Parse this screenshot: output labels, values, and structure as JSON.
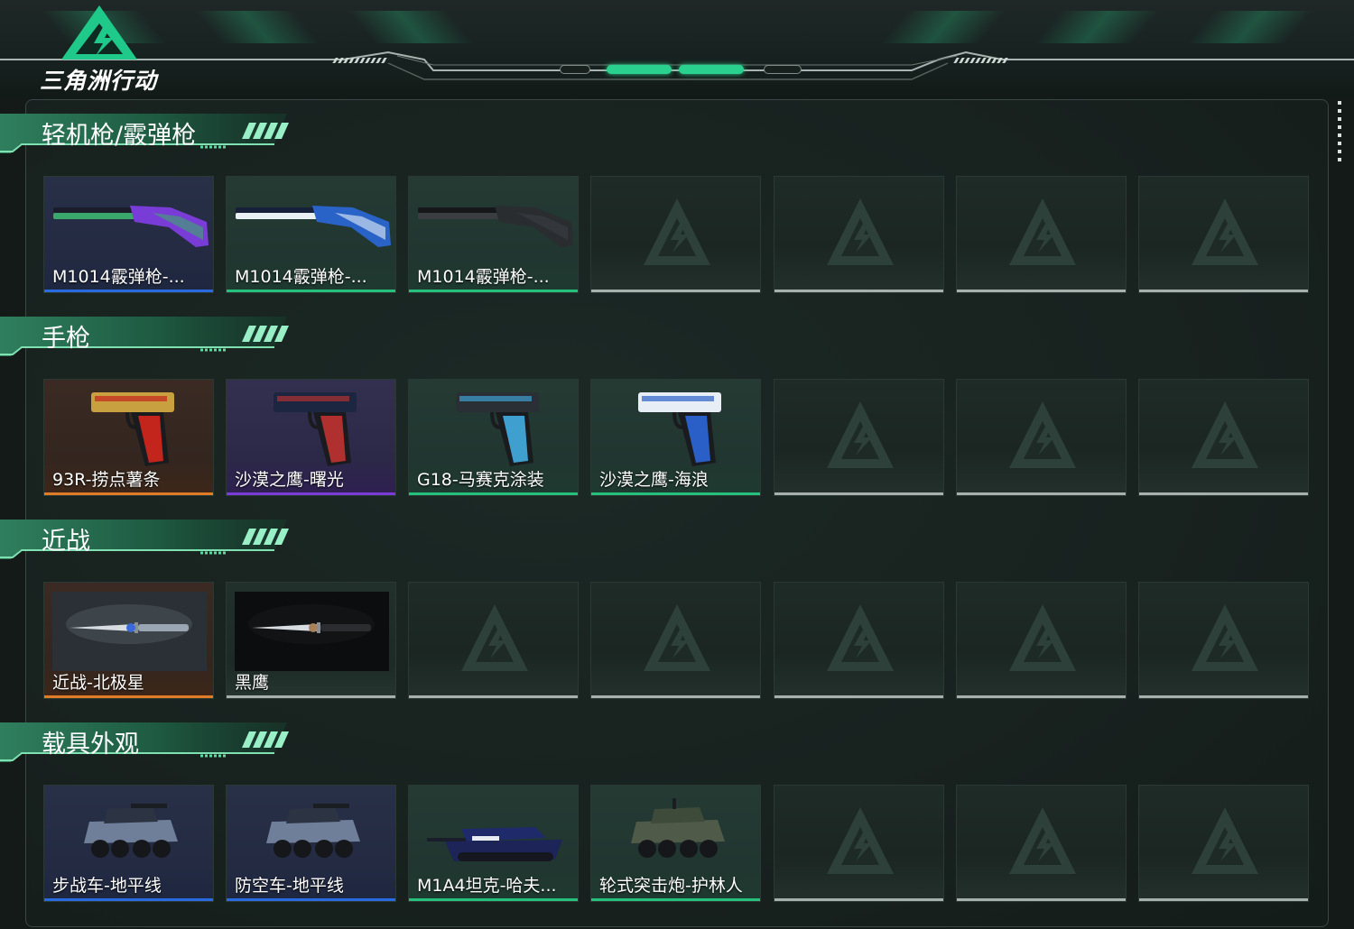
{
  "app": {
    "title": "三角洲行动"
  },
  "categories": [
    {
      "title": "轻机枪/霰弹枪",
      "items": [
        {
          "name": "M1014霰弹枪-...",
          "rarity": "blue",
          "icon": "shotgun-icon"
        },
        {
          "name": "M1014霰弹枪-...",
          "rarity": "green",
          "icon": "shotgun-icon"
        },
        {
          "name": "M1014霰弹枪-...",
          "rarity": "green",
          "icon": "shotgun-icon"
        }
      ],
      "empty_slots": 4
    },
    {
      "title": "手枪",
      "items": [
        {
          "name": "93R-捞点薯条",
          "rarity": "orange",
          "icon": "pistol-icon"
        },
        {
          "name": "沙漠之鹰-曙光",
          "rarity": "purple",
          "icon": "pistol-icon"
        },
        {
          "name": "G18-马赛克涂装",
          "rarity": "green",
          "icon": "pistol-icon"
        },
        {
          "name": "沙漠之鹰-海浪",
          "rarity": "green",
          "icon": "pistol-icon"
        }
      ],
      "empty_slots": 3
    },
    {
      "title": "近战",
      "items": [
        {
          "name": "近战-北极星",
          "rarity": "orange",
          "icon": "knife-icon"
        },
        {
          "name": "黑鹰",
          "rarity": "none",
          "icon": "knife-icon"
        }
      ],
      "empty_slots": 5
    },
    {
      "title": "载具外观",
      "items": [
        {
          "name": "步战车-地平线",
          "rarity": "blue",
          "icon": "armored-vehicle-icon"
        },
        {
          "name": "防空车-地平线",
          "rarity": "blue",
          "icon": "armored-vehicle-icon"
        },
        {
          "name": "M1A4坦克-哈夫...",
          "rarity": "green",
          "icon": "tank-icon"
        },
        {
          "name": "轮式突击炮-护林人",
          "rarity": "green",
          "icon": "armored-vehicle-icon"
        }
      ],
      "empty_slots": 3
    }
  ],
  "colors": {
    "accent": "#2ad08d",
    "rarity_blue": "#2a6ae0",
    "rarity_green": "#25c07c",
    "rarity_purple": "#7a3cd6",
    "rarity_orange": "#e07b28",
    "empty_bar": "#a7b0ad"
  }
}
